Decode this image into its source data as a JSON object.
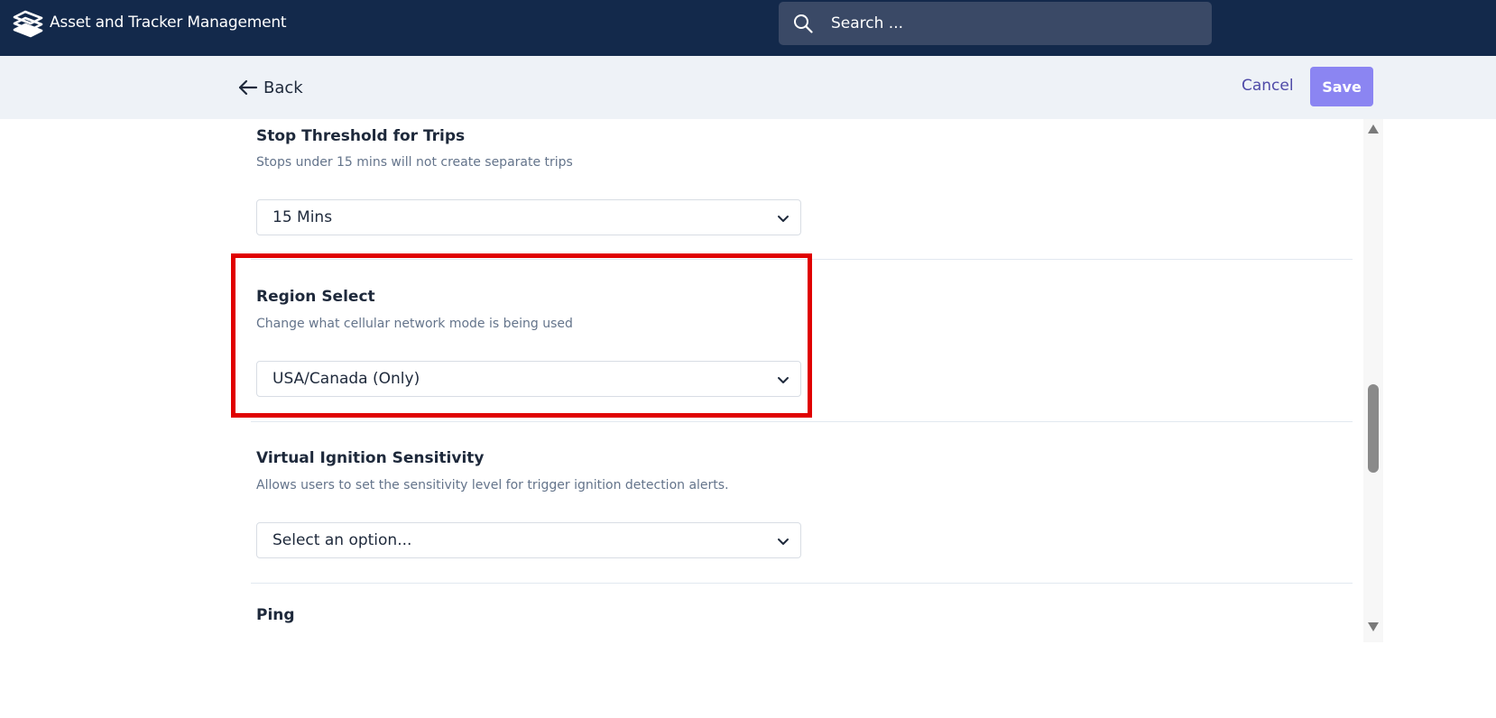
{
  "header": {
    "app_title": "Asset and Tracker Management",
    "search_placeholder": "Search ...",
    "logo_icon": "stacked-layers-logo",
    "search_icon": "search-icon"
  },
  "toolbar": {
    "back_label": "Back",
    "cancel_label": "Cancel",
    "save_label": "Save",
    "back_icon": "arrow-left-icon"
  },
  "settings": [
    {
      "title": "Stop Threshold for Trips",
      "description": "Stops under 15 mins will not create separate trips",
      "value": "15 Mins"
    },
    {
      "title": "Region Select",
      "description": "Change what cellular network mode is being used",
      "value": "USA/Canada (Only)"
    },
    {
      "title": "Virtual Ignition Sensitivity",
      "description": "Allows users to set the sensitivity level for trigger ignition detection alerts.",
      "value": "Select an option..."
    },
    {
      "title": "Ping"
    }
  ],
  "colors": {
    "header_bg": "#13294b",
    "subbar_bg": "#eef2f7",
    "save_bg": "#8b85f2",
    "cancel_text": "#4f4aa8",
    "highlight_border": "#e00000"
  }
}
